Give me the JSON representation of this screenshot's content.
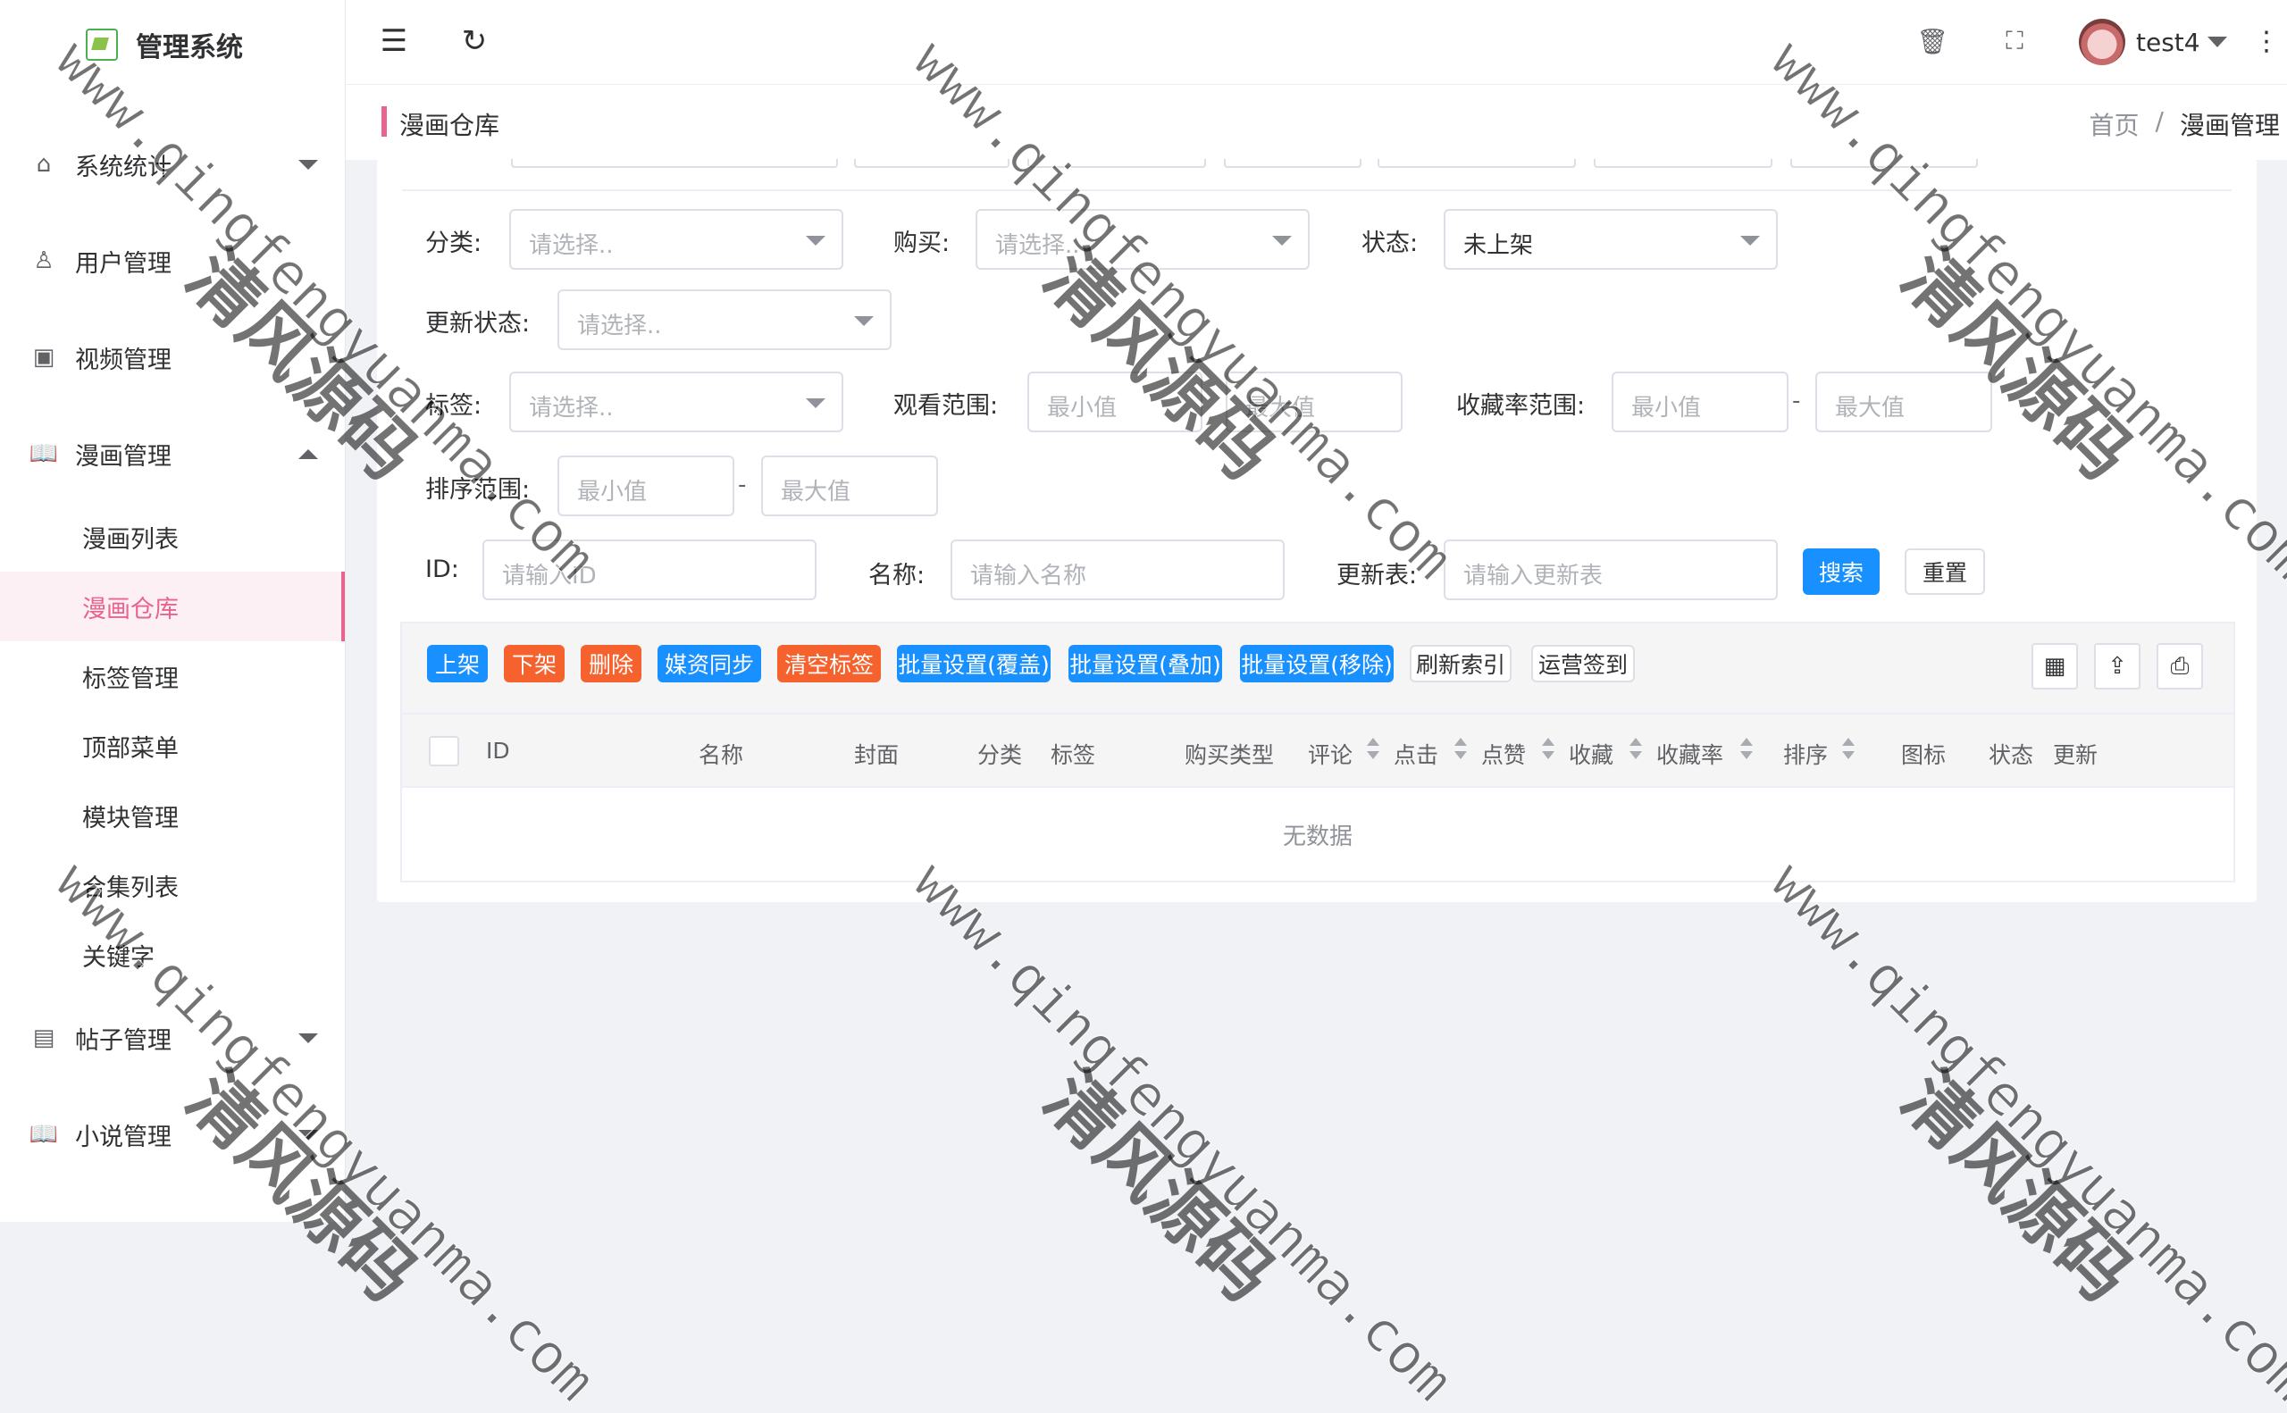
{
  "app": {
    "title": "管理系统"
  },
  "topbar": {
    "username": "test4"
  },
  "sidebar": {
    "items": [
      {
        "label": "系统统计",
        "icon": "home-icon",
        "expanded": false
      },
      {
        "label": "用户管理",
        "icon": "user-icon"
      },
      {
        "label": "视频管理",
        "icon": "video-icon"
      },
      {
        "label": "漫画管理",
        "icon": "book-icon",
        "expanded": true,
        "children": [
          "漫画列表",
          "漫画仓库",
          "标签管理",
          "顶部菜单",
          "模块管理",
          "合集列表",
          "关键字"
        ],
        "active_child": "漫画仓库"
      },
      {
        "label": "帖子管理",
        "icon": "document-icon",
        "expanded": false
      },
      {
        "label": "小说管理",
        "icon": "book-icon",
        "expanded": false
      }
    ]
  },
  "page": {
    "title": "漫画仓库",
    "breadcrumb": [
      "首页",
      "漫画管理"
    ],
    "breadcrumb_sep": "/"
  },
  "filters": {
    "category": {
      "label": "分类:",
      "placeholder": "请选择.."
    },
    "purchase": {
      "label": "购买:",
      "placeholder": "请选择.."
    },
    "status": {
      "label": "状态:",
      "value": "未上架"
    },
    "update_status": {
      "label": "更新状态:",
      "placeholder": "请选择.."
    },
    "tags": {
      "label": "标签:",
      "placeholder": "请选择.."
    },
    "view_range": {
      "label": "观看范围:",
      "min_placeholder": "最小值",
      "max_placeholder": "最大值"
    },
    "fav_rate_range": {
      "label": "收藏率范围:",
      "min_placeholder": "最小值",
      "max_placeholder": "最大值",
      "dash": "-"
    },
    "sort_range": {
      "label": "排序范围:",
      "min_placeholder": "最小值",
      "max_placeholder": "最大值",
      "dash": "-"
    },
    "id": {
      "label": "ID:",
      "placeholder": "请输入ID"
    },
    "name": {
      "label": "名称:",
      "placeholder": "请输入名称"
    },
    "update_table": {
      "label": "更新表:",
      "placeholder": "请输入更新表"
    },
    "search_label": "搜索",
    "reset_label": "重置"
  },
  "actions": {
    "shelve": "上架",
    "unshelve": "下架",
    "delete": "删除",
    "media_sync": "媒资同步",
    "clear_tags": "清空标签",
    "batch_overwrite": "批量设置(覆盖)",
    "batch_append": "批量设置(叠加)",
    "batch_remove": "批量设置(移除)",
    "refresh_index": "刷新索引",
    "ops_signin": "运营签到"
  },
  "table": {
    "columns": [
      "ID",
      "名称",
      "封面",
      "分类",
      "标签",
      "购买类型",
      "评论",
      "点击",
      "点赞",
      "收藏",
      "收藏率",
      "排序",
      "图标",
      "状态",
      "更新"
    ],
    "empty_text": "无数据"
  },
  "watermark": {
    "url": "www.qingfengyuanma.com",
    "cn": "清风源码"
  },
  "colors": {
    "accent": "#e8638e",
    "primary": "#1890ff",
    "danger": "#f5622d"
  }
}
